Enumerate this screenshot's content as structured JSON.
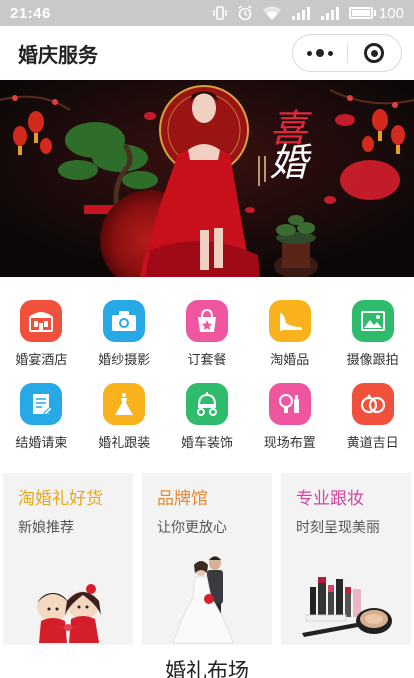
{
  "status_bar": {
    "time": "21:46",
    "battery": "100",
    "battery_level": 1.0
  },
  "header": {
    "title": "婚庆服务",
    "more_icon": "more-dots-icon",
    "close_icon": "target-close-icon"
  },
  "banner": {
    "headline_char_1": "喜",
    "headline_char_2": "婚",
    "colors": {
      "background": "#0c0808",
      "accent": "#e0283a"
    }
  },
  "categories": [
    {
      "label": "婚宴酒店",
      "icon": "hotel-icon",
      "color": "#f0503c"
    },
    {
      "label": "婚纱摄影",
      "icon": "camera-icon",
      "color": "#27a9e6"
    },
    {
      "label": "订套餐",
      "icon": "gift-bag-icon",
      "color": "#f055a0"
    },
    {
      "label": "淘婚品",
      "icon": "shoe-icon",
      "color": "#f9b21c"
    },
    {
      "label": "摄像跟拍",
      "icon": "photo-icon",
      "color": "#2ebb6c"
    },
    {
      "label": "结婚请柬",
      "icon": "invitation-icon",
      "color": "#27a9e6"
    },
    {
      "label": "婚礼跟装",
      "icon": "dress-icon",
      "color": "#f9b21c"
    },
    {
      "label": "婚车装饰",
      "icon": "carriage-icon",
      "color": "#2ebb6c"
    },
    {
      "label": "现场布置",
      "icon": "makeup-icon",
      "color": "#f055a0"
    },
    {
      "label": "黄道吉日",
      "icon": "rings-icon",
      "color": "#f0503c"
    }
  ],
  "promos": [
    {
      "title": "淘婚礼好货",
      "subtitle": "新娘推荐",
      "title_color": "#e6a817"
    },
    {
      "title": "品牌馆",
      "subtitle": "让你更放心",
      "title_color": "#e38a32"
    },
    {
      "title": "专业跟妆",
      "subtitle": "时刻呈现美丽",
      "title_color": "#d2469c"
    }
  ],
  "section": {
    "title": "婚礼布场"
  }
}
